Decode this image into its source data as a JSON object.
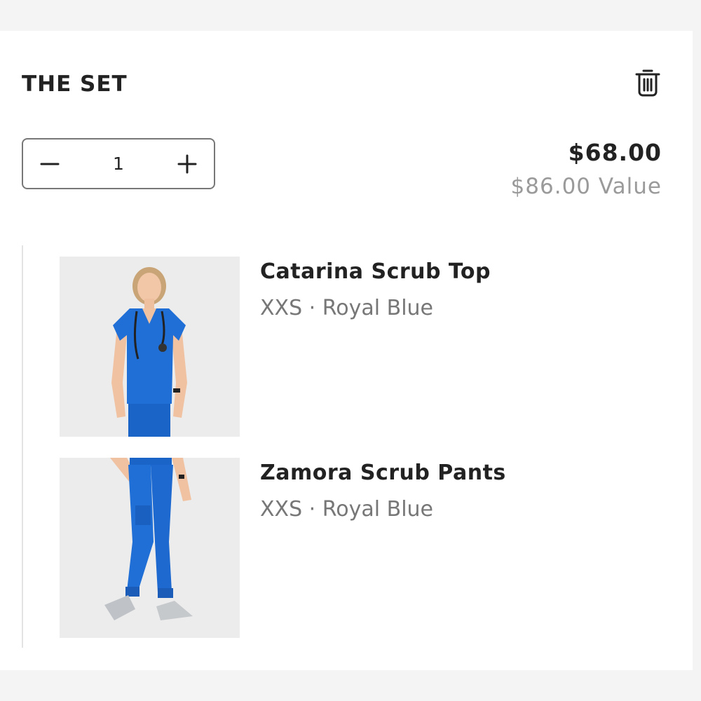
{
  "cart": {
    "title": "THE SET",
    "quantity": "1",
    "price": "$68.00",
    "value": "$86.00 Value",
    "items": [
      {
        "name": "Catarina Scrub Top",
        "variant": "XXS · Royal Blue"
      },
      {
        "name": "Zamora Scrub Pants",
        "variant": "XXS · Royal Blue"
      }
    ]
  },
  "icons": {
    "delete": "trash-icon",
    "decrease": "minus-icon",
    "increase": "plus-icon"
  },
  "colors": {
    "product": "#1f6fd6",
    "text": "#222222",
    "muted": "#777777",
    "value_text": "#9a9a9a"
  }
}
